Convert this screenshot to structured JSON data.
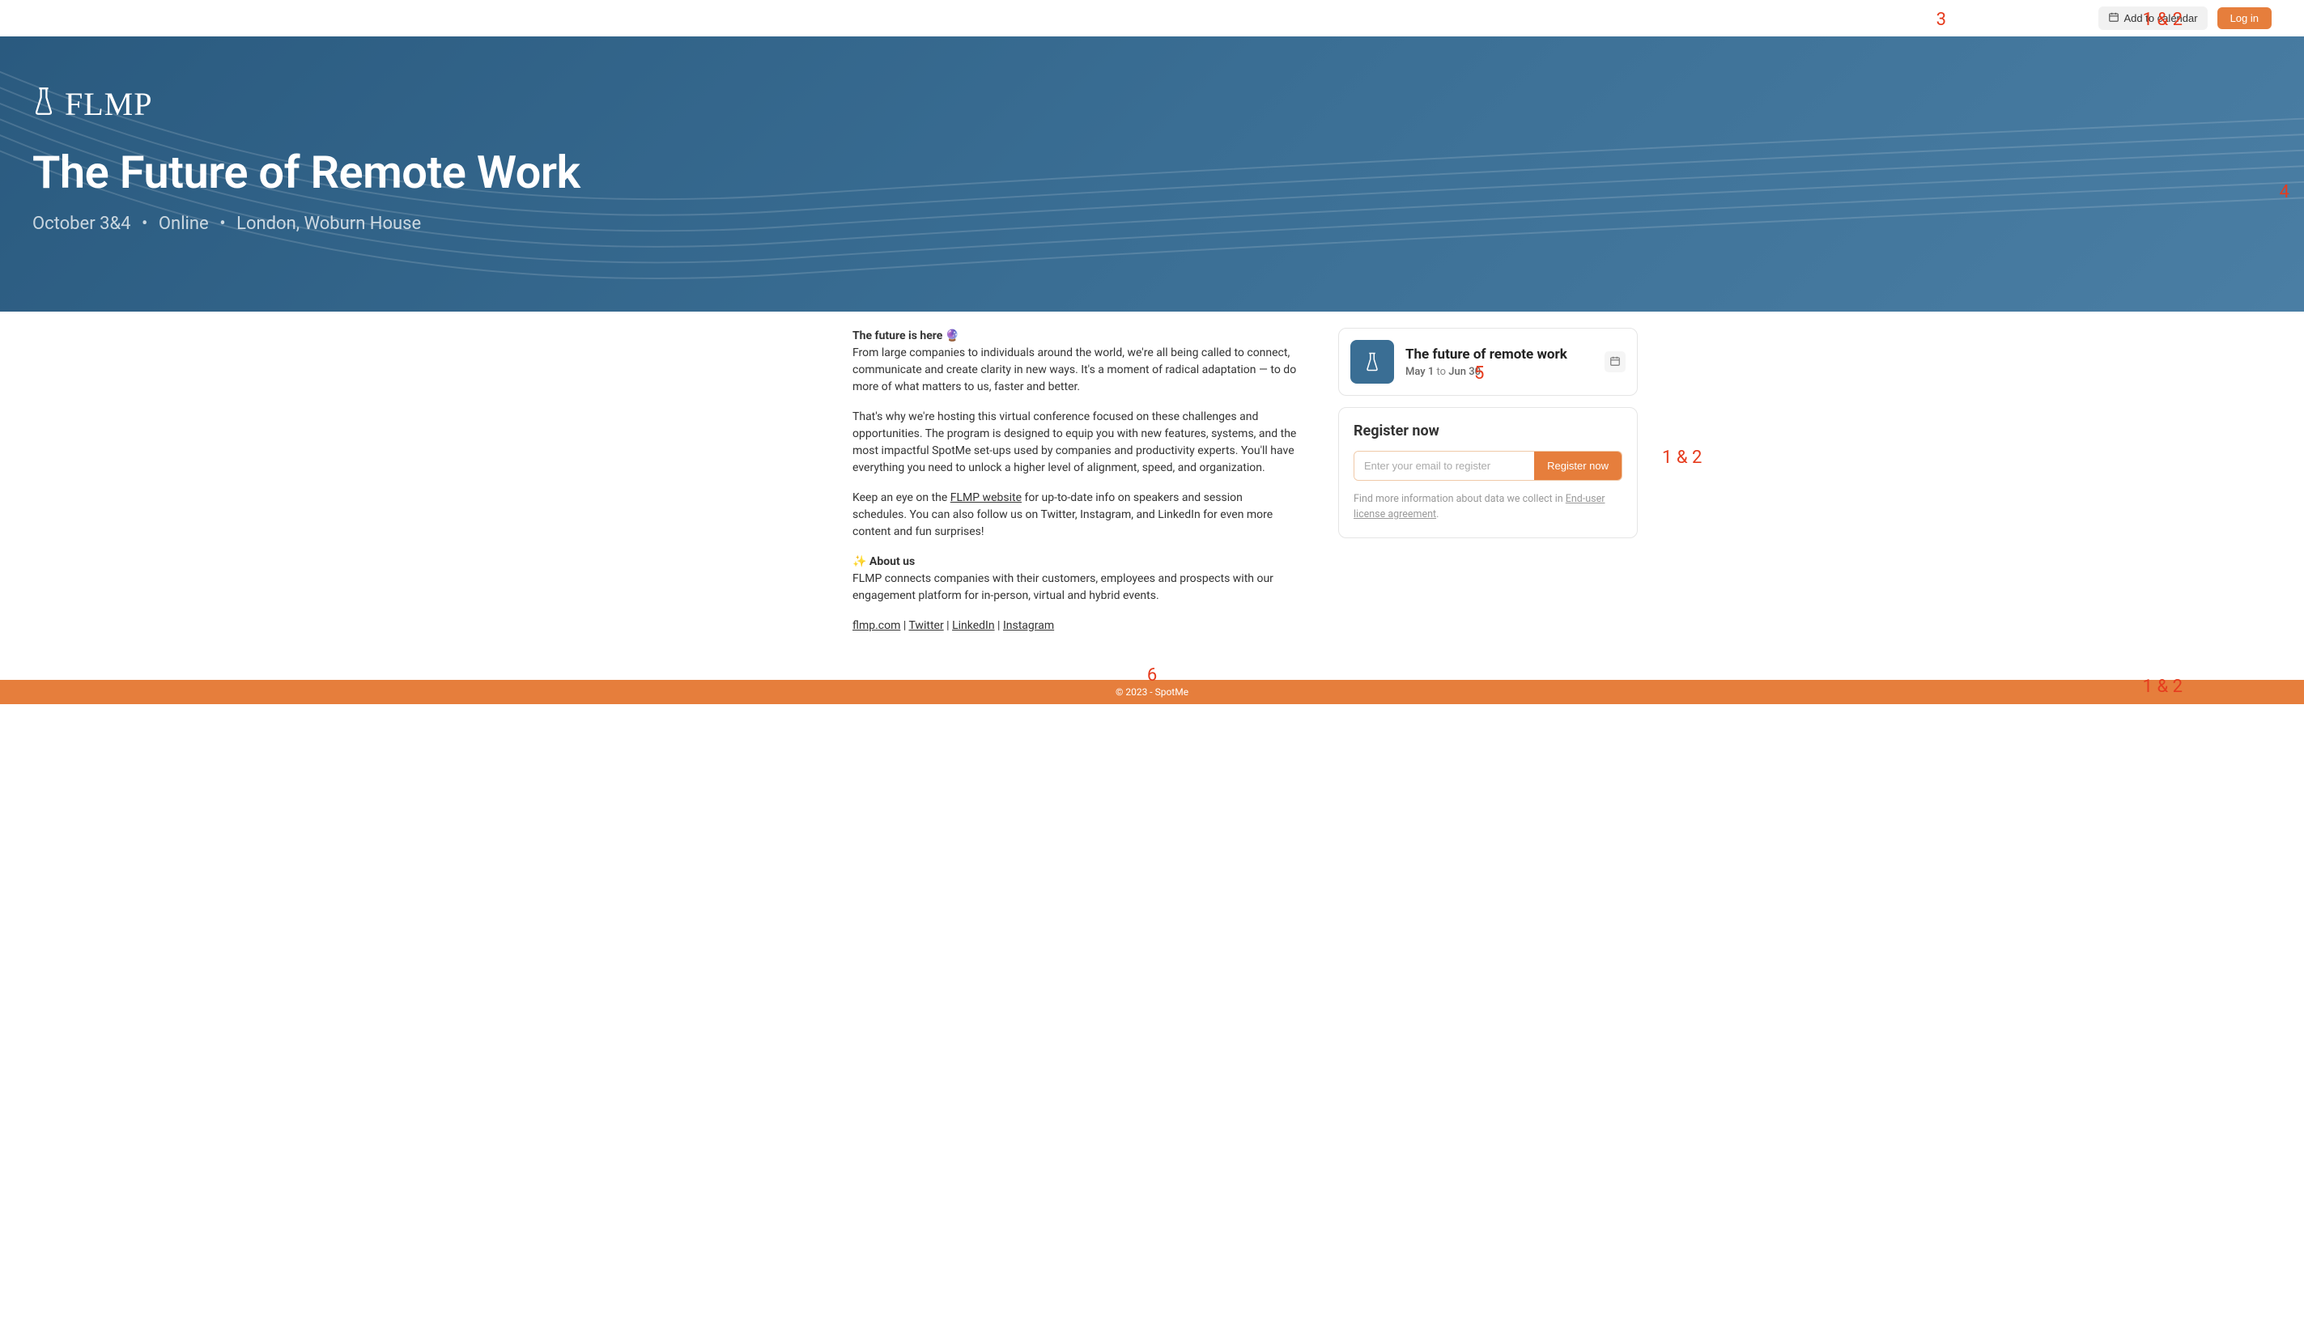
{
  "topbar": {
    "add_to_calendar": "Add to calendar",
    "login": "Log in"
  },
  "hero": {
    "logo_text": "FLMP",
    "title": "The Future of Remote Work",
    "date": "October 3&4",
    "format": "Online",
    "location": "London, Woburn House"
  },
  "body": {
    "heading1": "The future is here",
    "heading1_emoji": "🔮",
    "para1": "From large companies to individuals around the world, we're all being called to connect, communicate and create clarity in new ways. It's a moment of radical adaptation — to do more of what matters to us, faster and better.",
    "para2": "That's why we're hosting this virtual conference focused on these challenges and opportunities. The program is designed to equip you with new features, systems, and the most impactful SpotMe set-ups used by companies and productivity experts. You'll have everything you need to unlock a higher level of alignment, speed, and organization.",
    "para3_pre": "Keep an eye on the ",
    "para3_link": "FLMP website",
    "para3_post": " for up-to-date info on speakers and session schedules. You can also follow us on Twitter, Instagram, and LinkedIn for even more content and fun surprises!",
    "heading2_emoji": "✨",
    "heading2": " About us",
    "para4": "FLMP connects companies with their customers, employees and prospects with our engagement platform for in-person, virtual and hybrid events.",
    "links": {
      "site": "flmp.com",
      "sep": " | ",
      "twitter": "Twitter",
      "linkedin": "LinkedIn",
      "instagram": "Instagram"
    }
  },
  "event_card": {
    "title": "The future of remote work",
    "date_start": "May 1",
    "date_to": " to ",
    "date_end": "Jun 30"
  },
  "register": {
    "title": "Register now",
    "placeholder": "Enter your email to register",
    "button": "Register now",
    "info_pre": "Find more information about data we collect in ",
    "info_link": "End-user license agreement",
    "info_post": "."
  },
  "footer": {
    "text": "© 2023 - SpotMe"
  },
  "annotations": {
    "a1": "1 & 2",
    "a2": "3",
    "a3": "4",
    "a4": "5",
    "a5": "1 & 2",
    "a6": "6",
    "a7": "1 & 2"
  }
}
